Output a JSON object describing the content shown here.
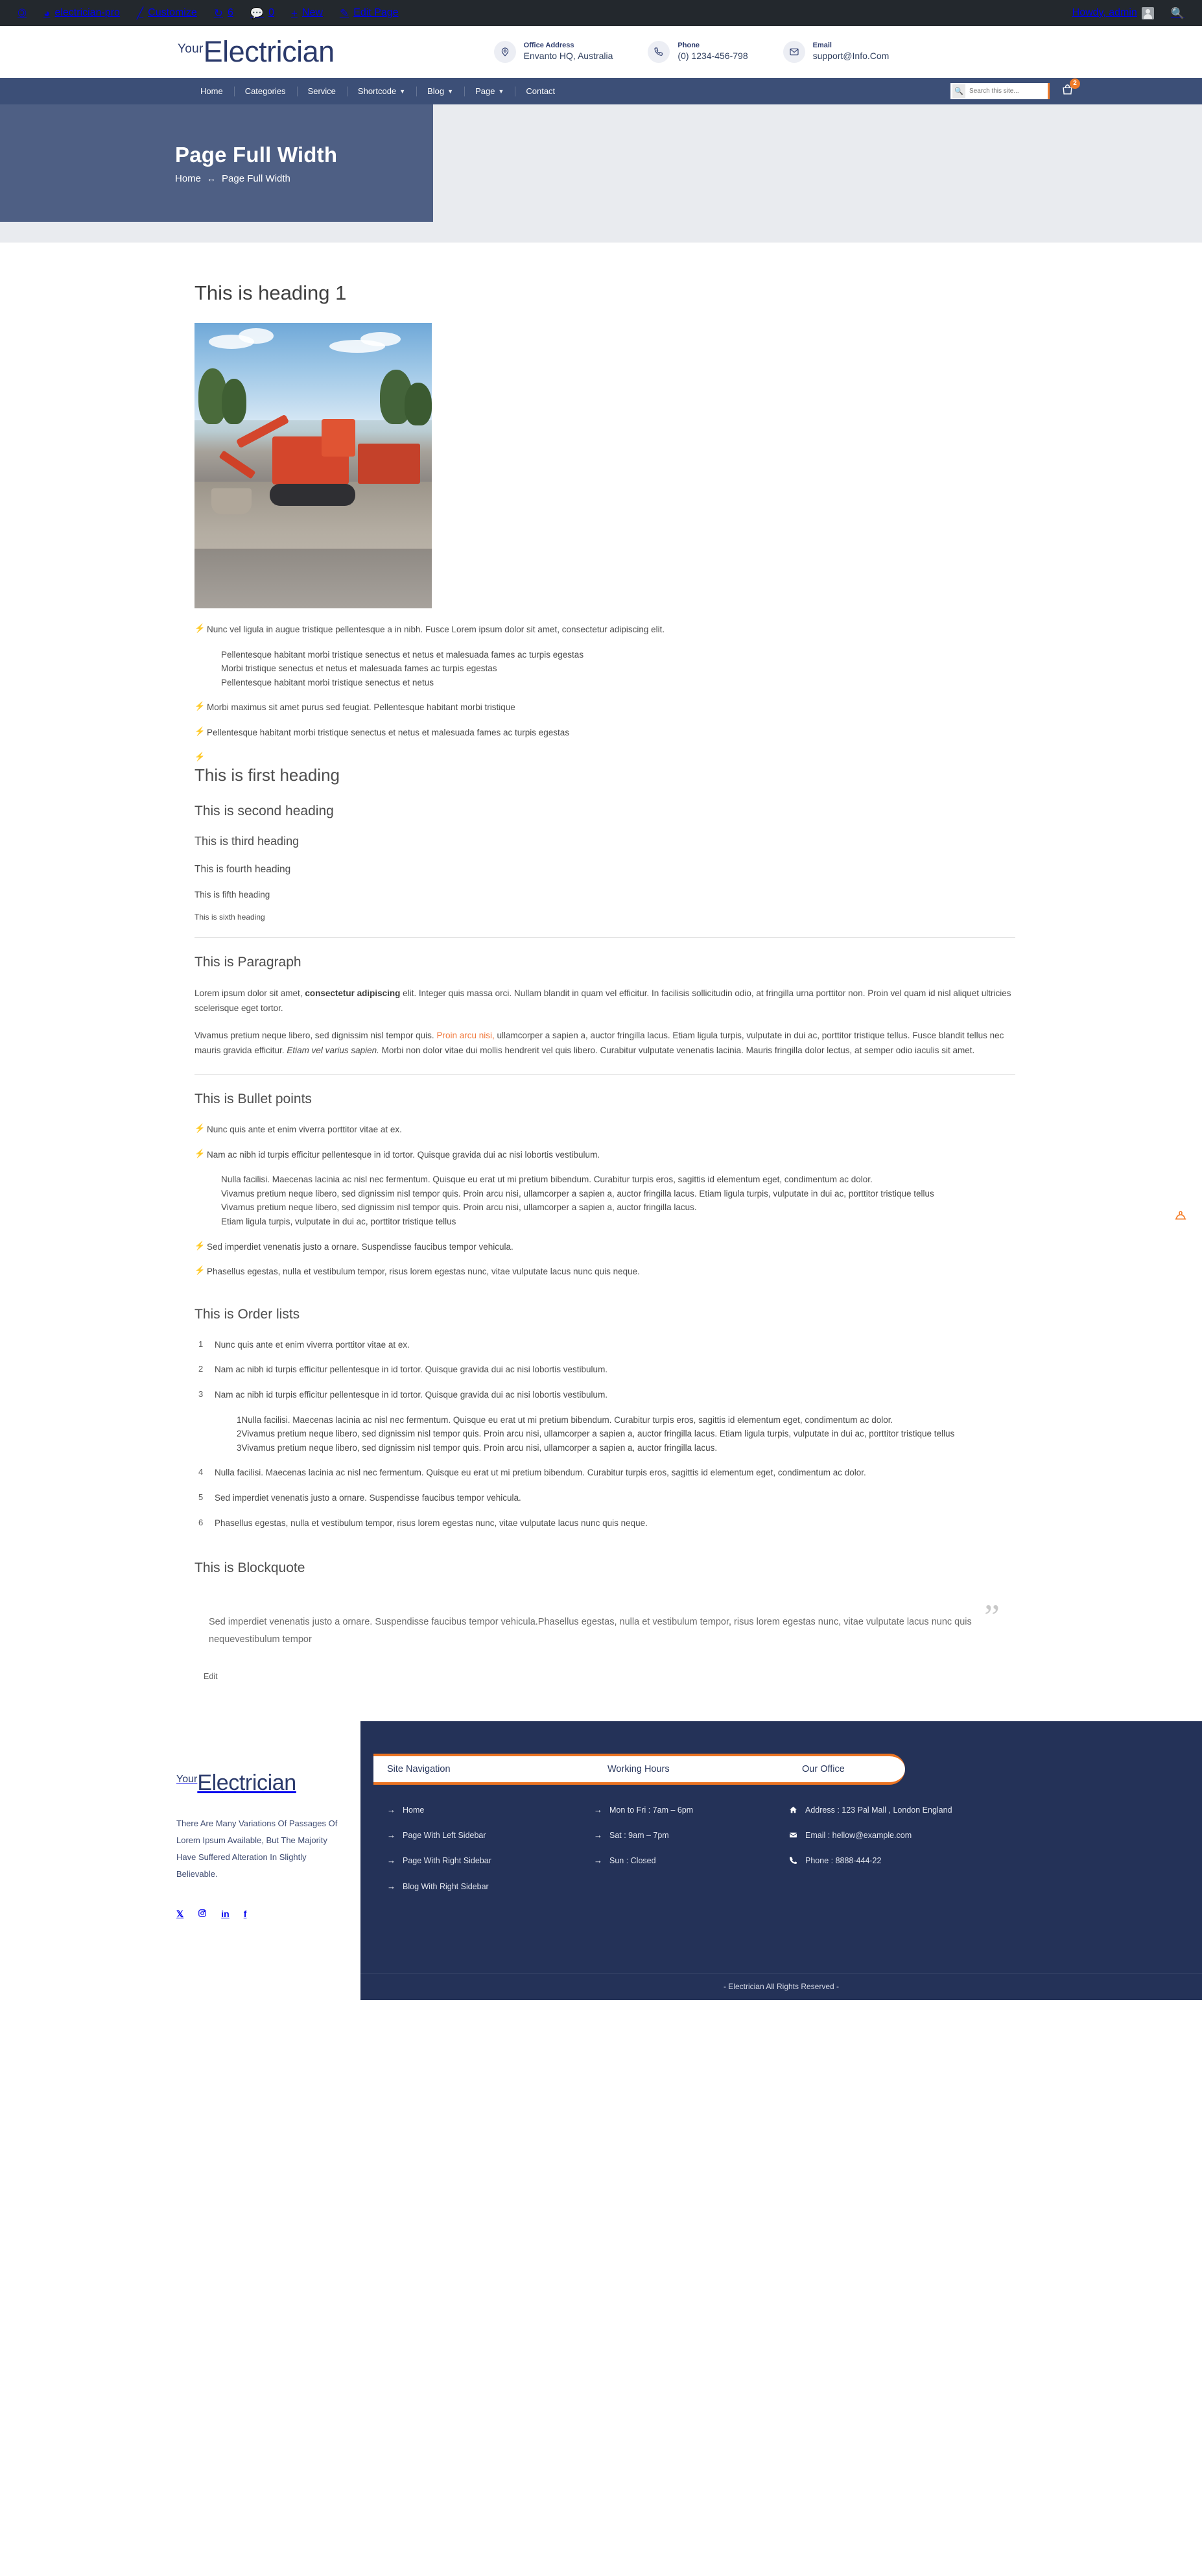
{
  "adminbar": {
    "items": [
      {
        "icon": "wordpress-logo-icon",
        "label": ""
      },
      {
        "icon": "dashboard-icon",
        "label": "electrician-pro"
      },
      {
        "icon": "customize-brush-icon",
        "label": "Customize"
      },
      {
        "icon": "updates-icon",
        "label": "6"
      },
      {
        "icon": "comments-icon",
        "label": "0"
      },
      {
        "icon": "plus-icon",
        "label": "New"
      },
      {
        "icon": "edit-pencil-icon",
        "label": "Edit Page"
      }
    ],
    "howdy": "Howdy, admin",
    "search_icon": "search-icon"
  },
  "header": {
    "brand": {
      "pre": "Your",
      "main": "Electrician"
    },
    "info": [
      {
        "icon": "map-pin-icon",
        "label": "Office Address",
        "value": "Envanto HQ, Australia"
      },
      {
        "icon": "phone-icon",
        "label": "Phone",
        "value": "(0) 1234-456-798"
      },
      {
        "icon": "envelope-icon",
        "label": "Email",
        "value": "support@Info.Com"
      }
    ]
  },
  "nav": {
    "items": [
      {
        "label": "Home",
        "caret": false
      },
      {
        "label": "Categories",
        "caret": false
      },
      {
        "label": "Service",
        "caret": false
      },
      {
        "label": "Shortcode",
        "caret": true
      },
      {
        "label": "Blog",
        "caret": true
      },
      {
        "label": "Page",
        "caret": true
      },
      {
        "label": "Contact",
        "caret": false
      }
    ],
    "search_placeholder": "Search this site...",
    "search_value": "",
    "search_icon": "search-icon",
    "cart_icon": "shopping-bag-icon",
    "cart_count": "2"
  },
  "banner": {
    "title": "Page Full Width",
    "crumb_home": "Home",
    "crumb_sep": "↔",
    "crumb_current": "Page Full Width"
  },
  "content": {
    "heading1": "This is heading 1",
    "image_alt": "excavator-construction-photo",
    "intro_list": [
      {
        "text": "Nunc vel ligula in augue tristique pellentesque a in nibh. Fusce Lorem ipsum dolor sit amet, consectetur adipiscing elit.",
        "children": [
          "Pellentesque habitant morbi tristique senectus et netus et malesuada fames ac turpis egestas",
          "Morbi tristique senectus et netus et malesuada fames ac turpis egestas",
          "Pellentesque habitant morbi tristique senectus et netus"
        ]
      },
      {
        "text": "Morbi maximus sit amet purus sed feugiat. Pellentesque habitant morbi tristique",
        "children": []
      },
      {
        "text": "Pellentesque habitant morbi tristique senectus et netus et malesuada fames ac turpis egestas",
        "children": []
      },
      {
        "text": "",
        "children": []
      }
    ],
    "headings": {
      "first": "This is first heading",
      "second": "This is second heading",
      "third": "This is third heading",
      "fourth": "This is fourth heading",
      "fifth": "This is fifth heading",
      "sixth": "This is sixth heading"
    },
    "paragraph_title": "This is Paragraph",
    "para1_a": "Lorem ipsum dolor sit amet, ",
    "para1_b": "consectetur adipiscing",
    "para1_c": " elit. Integer quis massa orci. Nullam blandit in quam vel efficitur. In facilisis sollicitudin odio, at fringilla urna porttitor non. Proin vel quam id nisl aliquet ultricies scelerisque eget tortor.",
    "para2_a": "Vivamus pretium neque libero, sed dignissim nisl tempor quis. ",
    "para2_link": "Proin arcu nisi,",
    "para2_b": " ullamcorper a sapien a, auctor fringilla lacus. Etiam ligula turpis, vulputate in dui ac, porttitor tristique tellus. Fusce blandit tellus nec mauris gravida efficitur. ",
    "para2_em": "Etiam vel varius sapien.",
    "para2_c": " Morbi non dolor vitae dui mollis hendrerit vel quis libero. Curabitur vulputate venenatis lacinia. Mauris fringilla dolor lectus, at semper odio iaculis sit amet.",
    "bullet_title": "This is Bullet points",
    "bullets": [
      {
        "text": "Nunc quis ante et enim viverra porttitor vitae at ex.",
        "children": []
      },
      {
        "text": "Nam ac nibh id turpis efficitur pellentesque in id tortor. Quisque gravida dui ac nisi lobortis vestibulum.",
        "children": [
          "Nulla facilisi. Maecenas lacinia ac nisl nec fermentum. Quisque eu erat ut mi pretium bibendum. Curabitur turpis eros, sagittis id elementum eget, condimentum ac dolor.",
          "Vivamus pretium neque libero, sed dignissim nisl tempor quis. Proin arcu nisi, ullamcorper a sapien a, auctor fringilla lacus. Etiam ligula turpis, vulputate in dui ac, porttitor tristique tellus",
          "Vivamus pretium neque libero, sed dignissim nisl tempor quis. Proin arcu nisi, ullamcorper a sapien a, auctor fringilla lacus.",
          "Etiam ligula turpis, vulputate in dui ac, porttitor tristique tellus"
        ]
      },
      {
        "text": "Sed imperdiet venenatis justo a ornare. Suspendisse faucibus tempor vehicula.",
        "children": []
      },
      {
        "text": "Phasellus egestas, nulla et vestibulum tempor, risus lorem egestas nunc, vitae vulputate lacus nunc quis neque.",
        "children": []
      }
    ],
    "order_title": "This is Order lists",
    "orders": [
      {
        "text": "Nunc quis ante et enim viverra porttitor vitae at ex.",
        "children": []
      },
      {
        "text": "Nam ac nibh id turpis efficitur pellentesque in id tortor. Quisque gravida dui ac nisi lobortis vestibulum.",
        "children": []
      },
      {
        "text": "Nam ac nibh id turpis efficitur pellentesque in id tortor. Quisque gravida dui ac nisi lobortis vestibulum.",
        "children": [
          "Nulla facilisi. Maecenas lacinia ac nisl nec fermentum. Quisque eu erat ut mi pretium bibendum. Curabitur turpis eros, sagittis id elementum eget, condimentum ac dolor.",
          "Vivamus pretium neque libero, sed dignissim nisl tempor quis. Proin arcu nisi, ullamcorper a sapien a, auctor fringilla lacus. Etiam ligula turpis, vulputate in dui ac, porttitor tristique tellus",
          "Vivamus pretium neque libero, sed dignissim nisl tempor quis. Proin arcu nisi, ullamcorper a sapien a, auctor fringilla lacus."
        ]
      },
      {
        "text": "Nulla facilisi. Maecenas lacinia ac nisl nec fermentum. Quisque eu erat ut mi pretium bibendum. Curabitur turpis eros, sagittis id elementum eget, condimentum ac dolor.",
        "children": []
      },
      {
        "text": "Sed imperdiet venenatis justo a ornare. Suspendisse faucibus tempor vehicula.",
        "children": []
      },
      {
        "text": "Phasellus egestas, nulla et vestibulum tempor, risus lorem egestas nunc, vitae vulputate lacus nunc quis neque.",
        "children": []
      }
    ],
    "blockquote_title": "This is Blockquote",
    "blockquote_mark": "”",
    "blockquote_text": "Sed imperdiet venenatis justo a ornare. Suspendisse faucibus tempor vehicula.Phasellus egestas, nulla et vestibulum tempor, risus lorem egestas nunc, vitae vulputate lacus nunc quis nequevestibulum tempor",
    "edit_label": "Edit"
  },
  "float_button": {
    "icon": "hard-hat-icon"
  },
  "footer": {
    "brand": {
      "pre": "Your",
      "main": "Electrician"
    },
    "description": "There Are Many Variations Of Passages Of Lorem Ipsum Available, But The Majority Have Suffered Alteration In Slightly Believable.",
    "social": [
      {
        "icon": "x-twitter-icon",
        "label": "𝕏"
      },
      {
        "icon": "instagram-icon",
        "label": ""
      },
      {
        "icon": "linkedin-icon",
        "label": "in"
      },
      {
        "icon": "facebook-icon",
        "label": "f"
      }
    ],
    "tabs": [
      {
        "label": "Site Navigation"
      },
      {
        "label": "Working Hours"
      },
      {
        "label": "Our Office"
      }
    ],
    "site_navigation": [
      {
        "icon": "arrow-right-icon",
        "label": "Home"
      },
      {
        "icon": "arrow-right-icon",
        "label": "Page With Left Sidebar"
      },
      {
        "icon": "arrow-right-icon",
        "label": "Page With Right Sidebar"
      },
      {
        "icon": "arrow-right-icon",
        "label": "Blog With Right Sidebar"
      }
    ],
    "working_hours": [
      {
        "icon": "arrow-right-icon",
        "label": "Mon to Fri : 7am – 6pm"
      },
      {
        "icon": "arrow-right-icon",
        "label": "Sat : 9am – 7pm"
      },
      {
        "icon": "arrow-right-icon",
        "label": "Sun : Closed"
      }
    ],
    "our_office": [
      {
        "icon": "home-icon",
        "label": "Address : 123 Pal Mall , London England"
      },
      {
        "icon": "envelope-icon",
        "label": "Email : hellow@example.com"
      },
      {
        "icon": "phone-icon",
        "label": "Phone : 8888-444-22"
      }
    ],
    "copyright": "- Electrician All Rights Reserved -"
  },
  "colors": {
    "admin_bar": "#23282d",
    "brand_navy": "#2b3a6b",
    "nav_bar": "#3c4f77",
    "banner_box": "#4e5f84",
    "banner_strip": "#e9ebef",
    "accent_orange": "#f0773a",
    "footer_navy": "#243258",
    "footer_tab_border": "#ea7423"
  }
}
